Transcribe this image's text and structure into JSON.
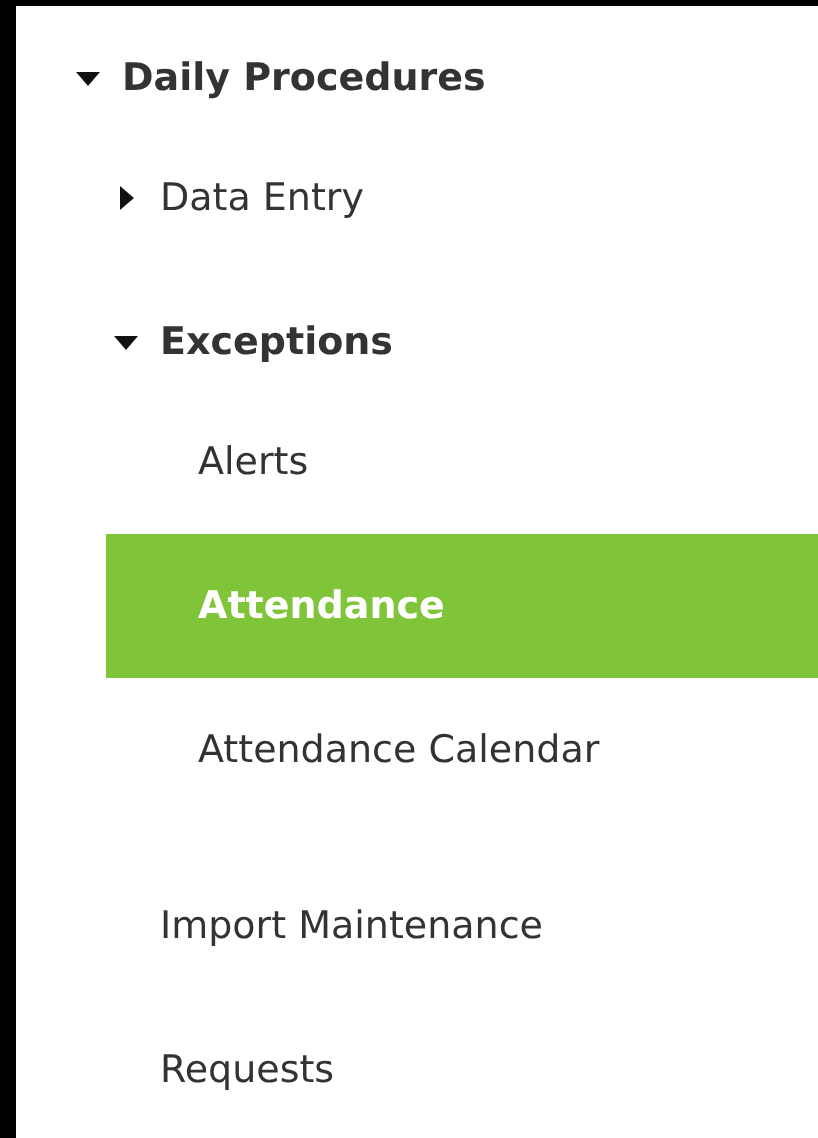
{
  "tree": [
    {
      "label": "Daily Procedures",
      "expanded": true,
      "selected": false,
      "children": [
        {
          "label": "Data Entry",
          "expanded": false,
          "selected": false
        },
        {
          "label": "Exceptions",
          "expanded": true,
          "selected": false,
          "children": [
            {
              "label": "Alerts",
              "selected": false
            },
            {
              "label": "Attendance",
              "selected": true
            },
            {
              "label": "Attendance Calendar",
              "selected": false
            }
          ]
        },
        {
          "label": "Import Maintenance",
          "selected": false
        },
        {
          "label": "Requests",
          "selected": false
        }
      ]
    }
  ]
}
